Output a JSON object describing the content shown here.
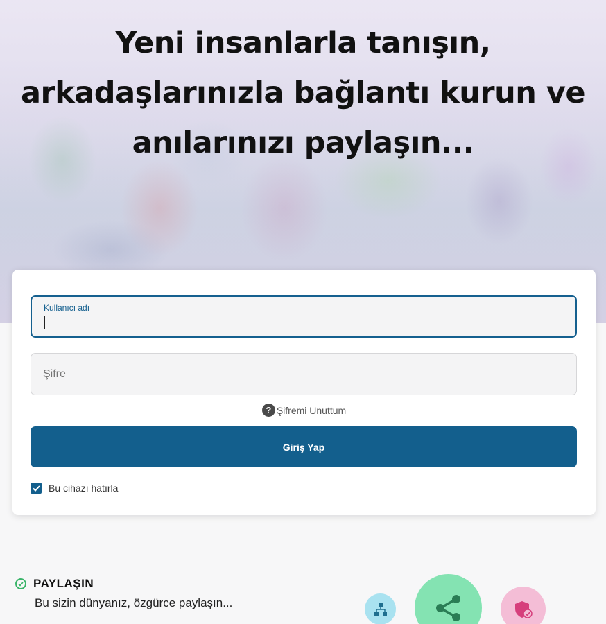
{
  "hero": {
    "heading": "Yeni insanlarla tanışın,\narkadaşlarınızla bağlantı kurun ve\nanılarınızı paylaşın..."
  },
  "login": {
    "username": {
      "label": "Kullanıcı adı",
      "value": ""
    },
    "password": {
      "placeholder": "Şifre",
      "value": ""
    },
    "forgot_label": "Şifremi Unuttum",
    "submit_label": "Giriş Yap",
    "remember": {
      "label": "Bu cihazı hatırla",
      "checked": true
    }
  },
  "feature": {
    "title": "PAYLAŞIN",
    "description": "Bu sizin dünyanız, özgürce paylaşın..."
  },
  "icons": [
    "sitemap-icon",
    "share-icon",
    "shield-check-icon"
  ],
  "colors": {
    "primary": "#135f8d",
    "check": "#3bb56a",
    "sitemap_bg": "#a9e2f0",
    "share_bg": "#84e3b2",
    "shield_bg": "#f4bdd6"
  }
}
